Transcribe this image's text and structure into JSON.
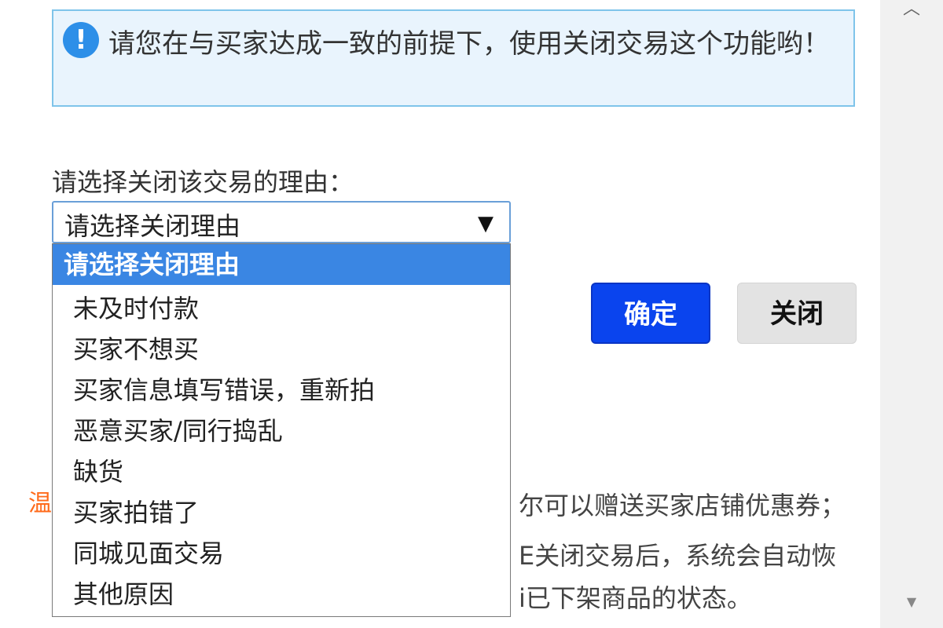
{
  "notice": {
    "icon": "exclamation-icon",
    "text": "请您在与买家达成一致的前提下，使用关闭交易这个功能哟！"
  },
  "form": {
    "reason_label": "请选择关闭该交易的理由：",
    "select_value": "请选择关闭理由",
    "options": [
      "请选择关闭理由",
      "未及时付款",
      "买家不想买",
      "买家信息填写错误，重新拍",
      "恶意买家/同行捣乱",
      "缺货",
      "买家拍错了",
      "同城见面交易",
      "其他原因"
    ]
  },
  "buttons": {
    "confirm": "确定",
    "close": "关闭"
  },
  "tips": {
    "prefix": "温",
    "line1": "尔可以赠送买家店铺优惠券；",
    "line2": "E关闭交易后，系统会自动恢",
    "line3": "i已下架商品的状态。"
  },
  "colors": {
    "accent": "#0a44ee",
    "selected_option": "#3a86e3",
    "notice_bg": "#e9f4fd",
    "tips_prefix": "#ff6a1a"
  }
}
